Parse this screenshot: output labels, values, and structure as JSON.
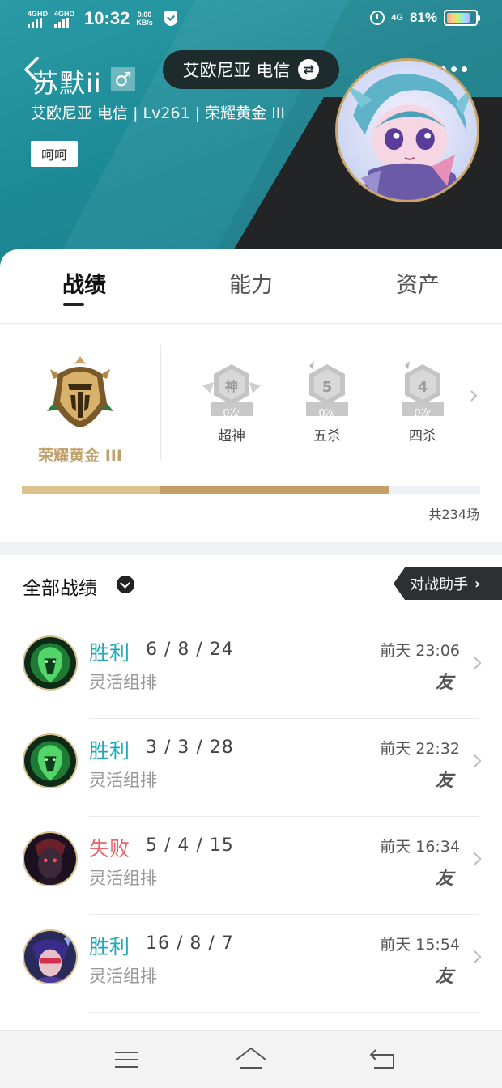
{
  "status_bar": {
    "sim1": "4GHD",
    "sim2": "4GHD",
    "time": "10:32",
    "speed_value": "0.00",
    "speed_unit": "KB/s",
    "network": "4G",
    "battery": "81%"
  },
  "profile": {
    "username": "苏默ii",
    "gender_symbol": "♂",
    "server": "艾欧尼亚 电信",
    "subline": "艾欧尼亚 电信 | Lv261 | 荣耀黄金 III",
    "tag": "呵呵"
  },
  "tabs": [
    {
      "label": "战绩",
      "active": true
    },
    {
      "label": "能力",
      "active": false
    },
    {
      "label": "资产",
      "active": false
    }
  ],
  "rank": {
    "name": "荣耀黄金 III",
    "progress_fraction": 0.8,
    "total": "共234场",
    "badges": [
      {
        "icon_text": "神",
        "count": "0次",
        "label": "超神"
      },
      {
        "icon_text": "5",
        "count": "0次",
        "label": "五杀"
      },
      {
        "icon_text": "4",
        "count": "0次",
        "label": "四杀"
      }
    ]
  },
  "records": {
    "title": "全部战绩",
    "assistant_label": "对战助手",
    "matches": [
      {
        "result": "胜利",
        "outcome": "win",
        "kda": "6 / 8 / 24",
        "mode": "灵活组排",
        "time": "前天 23:06",
        "friend": "友",
        "champ": "green"
      },
      {
        "result": "胜利",
        "outcome": "win",
        "kda": "3 / 3 / 28",
        "mode": "灵活组排",
        "time": "前天 22:32",
        "friend": "友",
        "champ": "green"
      },
      {
        "result": "失败",
        "outcome": "lose",
        "kda": "5 / 4 / 15",
        "mode": "灵活组排",
        "time": "前天 16:34",
        "friend": "友",
        "champ": "dark"
      },
      {
        "result": "胜利",
        "outcome": "win",
        "kda": "16 / 8 / 7",
        "mode": "灵活组排",
        "time": "前天 15:54",
        "friend": "友",
        "champ": "purple"
      }
    ]
  },
  "nav": [
    "menu-icon",
    "home-icon",
    "back-icon"
  ],
  "colors": {
    "header_teal": "#1d8a96",
    "win": "#23a9b8",
    "lose": "#e9676c",
    "gold": "#c09f68"
  }
}
